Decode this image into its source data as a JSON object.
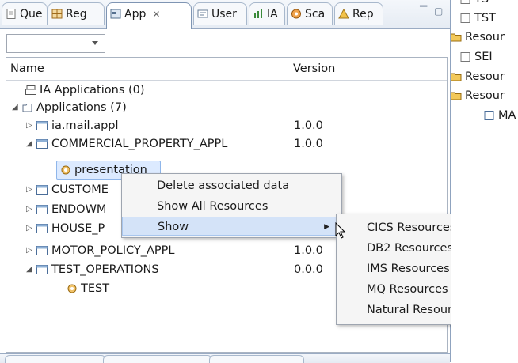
{
  "tabs": [
    {
      "label": "Que",
      "icon": "page-icon"
    },
    {
      "label": "Reg",
      "icon": "grid-icon"
    },
    {
      "label": "App",
      "icon": "app-icon",
      "active": true
    },
    {
      "label": "User",
      "icon": "user-icon"
    },
    {
      "label": "IA",
      "icon": "chart-icon"
    },
    {
      "label": "Sca",
      "icon": "scan-icon"
    },
    {
      "label": "Rep",
      "icon": "report-icon"
    }
  ],
  "table": {
    "columns": [
      "Name",
      "Version"
    ],
    "rows": [
      {
        "name": "IA Applications (0)",
        "version": ""
      },
      {
        "name": "Applications (7)",
        "version": ""
      },
      {
        "name": "ia.mail.appl",
        "version": "1.0.0"
      },
      {
        "name": "COMMERCIAL_PROPERTY_APPL",
        "version": "1.0.0"
      },
      {
        "name": "presentation",
        "version": ""
      },
      {
        "name": "CUSTOME",
        "version": ""
      },
      {
        "name": "ENDOWM",
        "version": ""
      },
      {
        "name": "HOUSE_P",
        "version": ""
      },
      {
        "name": "MOTOR_POLICY_APPL",
        "version": "1.0.0"
      },
      {
        "name": "TEST_OPERATIONS",
        "version": "0.0.0"
      },
      {
        "name": "TEST",
        "version": ""
      }
    ]
  },
  "context_menu": {
    "items": [
      "Delete associated data",
      "Show All Resources",
      "Show"
    ]
  },
  "submenu": {
    "items": [
      "CICS Resources",
      "DB2 Resources",
      "IMS Resources",
      "MQ Resources",
      "Natural Resources"
    ]
  },
  "right_panel": {
    "items": [
      "TS",
      "TST",
      "Resour",
      "SEI",
      "Resour",
      "Resour",
      "MA"
    ]
  },
  "colors": {
    "selection": "#dceaff",
    "menu_highlight": "#d4e3f8",
    "folder": "#e8b84a"
  }
}
